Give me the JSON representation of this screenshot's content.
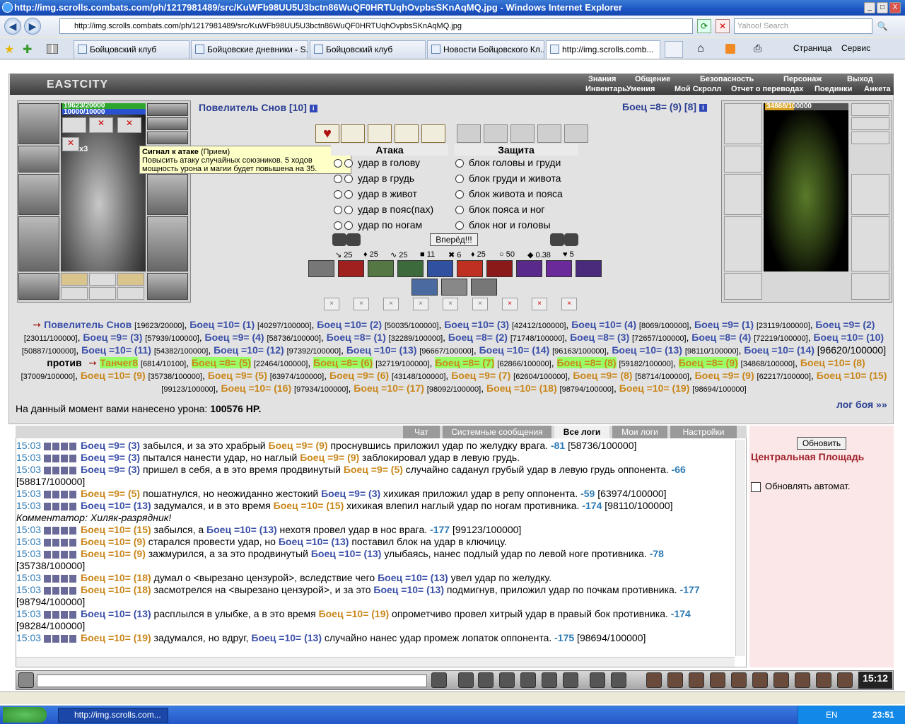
{
  "window": {
    "title": "http://img.scrolls.combats.com/ph/1217981489/src/KuWFb98UU5U3bctn86WuQF0HRTUqhOvpbsSKnAqMQ.jpg - Windows Internet Explorer",
    "min": "_",
    "max": "□",
    "close": "X"
  },
  "browser": {
    "url": "http://img.scrolls.combats.com/ph/1217981489/src/KuWFb98UU5U3bctn86WuQF0HRTUqhOvpbsSKnAqMQ.jpg",
    "search_placeholder": "Yahoo! Search",
    "page_menu": "Страница",
    "tools_menu": "Сервис"
  },
  "tabs": [
    {
      "label": "Бойцовский клуб"
    },
    {
      "label": "Бойцовские дневники - S..."
    },
    {
      "label": "Бойцовский клуб"
    },
    {
      "label": "Новости Бойцовского Кл..."
    },
    {
      "label": "http://img.scrolls.comb..."
    }
  ],
  "game": {
    "logo": "EASTCITY",
    "menu_top": [
      "Знания",
      "Общение",
      "Безопасность",
      "Персонаж",
      "Выход"
    ],
    "menu_bottom": [
      "Инвентарь",
      "Умения",
      "Мой Скролл",
      "Отчет о переводах",
      "Поединки",
      "Анкета"
    ],
    "left_player": {
      "name": "Повелитель Снов [10]",
      "hp": "19623/20000",
      "mana": "10000/10000",
      "mult": "x3"
    },
    "right_player": {
      "name": "Боец =8= (9) [8]",
      "hp": "34868/100000"
    },
    "tooltip": {
      "title": "Сигнал к атаке",
      "type": "(Прием)",
      "text": "Повысить атаку случайных союзников. 5 ходов мощность урона и магии будет повышена на 35."
    },
    "attack_header": "Атака",
    "defense_header": "Защита",
    "attacks": [
      "удар в голову",
      "удар в грудь",
      "удар в живот",
      "удар в пояс(пах)",
      "удар по ногам"
    ],
    "blocks": [
      "блок головы и груди",
      "блок груди и живота",
      "блок живота и пояса",
      "блок пояса и ног",
      "блок ног и головы"
    ],
    "forward_button": "Вперёд!!!",
    "stats": [
      "25",
      "25",
      "25",
      "11",
      "6",
      "25",
      "50",
      "0.38",
      "5"
    ],
    "damage_label": "На данный момент вами нанесено урона:",
    "damage_value": "100576 HP.",
    "battle_log_link": "лог боя »»",
    "vs": "против",
    "team1": [
      {
        "n": "Повелитель Снов",
        "hp": "[19623/20000]"
      },
      {
        "n": "Боец =10= (1)",
        "hp": "[40297/100000]"
      },
      {
        "n": "Боец =10= (2)",
        "hp": "[50035/100000]"
      },
      {
        "n": "Боец =10= (3)",
        "hp": "[42412/100000]"
      },
      {
        "n": "Боец =10= (4)",
        "hp": "[8069/100000]"
      },
      {
        "n": "Боец =9= (1)",
        "hp": "[23119/100000]"
      },
      {
        "n": "Боец =9= (2)",
        "hp": "[23011/100000]"
      },
      {
        "n": "Боец =9= (3)",
        "hp": "[57939/100000]"
      },
      {
        "n": "Боец =9= (4)",
        "hp": "[58736/100000]"
      },
      {
        "n": "Боец =8= (1)",
        "hp": "[32289/100000]"
      },
      {
        "n": "Боец =8= (2)",
        "hp": "[71748/100000]"
      },
      {
        "n": "Боец =8= (3)",
        "hp": "[72657/100000]"
      },
      {
        "n": "Боец =8= (4)",
        "hp": "[72219/100000]"
      },
      {
        "n": "Боец =10= (10)",
        "hp": "[50887/100000]"
      },
      {
        "n": "Боец =10= (11)",
        "hp": "[54382/100000]"
      },
      {
        "n": "Боец =10= (12)",
        "hp": "[97392/100000]"
      },
      {
        "n": "Боец =10= (13)",
        "hp": "[96667/100000]"
      },
      {
        "n": "Боец =10= (14)",
        "hp": "[96163/100000]"
      }
    ],
    "team1_last_hp": "[98110/100000]",
    "team2": [
      {
        "n": "Танчег8",
        "hp": "[6814/10100]",
        "hl": true
      },
      {
        "n": "Боец =8= (5)",
        "hp": "[22464/100000]",
        "hl": true
      },
      {
        "n": "Боец =8= (6)",
        "hp": "[32719/100000]",
        "hl": true
      },
      {
        "n": "Боец =8= (7)",
        "hp": "[62866/100000]",
        "hl": true
      },
      {
        "n": "Боец =8= (8)",
        "hp": "[59182/100000]",
        "hl": true
      },
      {
        "n": "Боец =8= (9)",
        "hp": "[34868/100000]",
        "hl": true
      },
      {
        "n": "Боец =10= (8)",
        "hp": "[37009/100000]"
      },
      {
        "n": "Боец =10= (9)",
        "hp": "[35738/100000]"
      },
      {
        "n": "Боец =9= (5)",
        "hp": "[63974/100000]"
      },
      {
        "n": "Боец =9= (6)",
        "hp": "[43148/100000]"
      },
      {
        "n": "Боец =9= (7)",
        "hp": "[62604/100000]"
      },
      {
        "n": "Боец =9= (8)",
        "hp": "[58714/100000]"
      },
      {
        "n": "Боец =9= (9)",
        "hp": "[62217/100000]"
      },
      {
        "n": "Боец =10= (15)",
        "hp": "[99123/100000]"
      },
      {
        "n": "Боец =10= (16)",
        "hp": "[97934/100000]"
      },
      {
        "n": "Боец =10= (17)",
        "hp": "[98092/100000]"
      },
      {
        "n": "Боец =10= (18)",
        "hp": "[98794/100000]"
      },
      {
        "n": "Боец =10= (19)",
        "hp": "[98694/100000]"
      }
    ]
  },
  "chat": {
    "tabs": [
      "Чат",
      "Системные сообщения",
      "Все логи",
      "Мои логи",
      "Настройки"
    ],
    "refresh_button": "Обновить",
    "location": "Центральная Площадь",
    "auto_refresh": "Обновлять автомат.",
    "log": [
      {
        "t": "15:03",
        "a": "Боец =9= (3)",
        "ac": "blue",
        "m": " забылся, и за это храбрый ",
        "b": "Боец =9= (9)",
        "bc": "orange",
        "e": " проснувшись приложил удар по желудку врага. ",
        "d": "-81",
        "hp": " [58736/100000]"
      },
      {
        "t": "15:03",
        "a": "Боец =9= (3)",
        "ac": "blue",
        "m": " пытался нанести удар, но наглый ",
        "b": "Боец =9= (9)",
        "bc": "orange",
        "e": " заблокировал удар в левую грудь.",
        "d": "",
        "hp": ""
      },
      {
        "t": "15:03",
        "a": "Боец =9= (3)",
        "ac": "blue",
        "m": " пришел в себя, а в это время продвинутый ",
        "b": "Боец =9= (5)",
        "bc": "orange",
        "e": " случайно саданул грубый удар в левую грудь оппонента. ",
        "d": "-66",
        "hp": " [58817/100000]"
      },
      {
        "t": "15:03",
        "a": "Боец =9= (5)",
        "ac": "orange",
        "m": " пошатнулся, но неожиданно жестокий ",
        "b": "Боец =9= (3)",
        "bc": "blue",
        "e": " хихикая приложил удар в репу оппонента. ",
        "d": "-59",
        "hp": " [63974/100000]"
      },
      {
        "t": "15:03",
        "a": "Боец =10= (13)",
        "ac": "blue",
        "m": " задумался, и в это время ",
        "b": "Боец =10= (15)",
        "bc": "orange",
        "e": " хихикая влепил наглый удар по ногам противника. ",
        "d": "-174",
        "hp": " [98110/100000]"
      },
      {
        "comment": "Комментатор: Хиляк-разрядник!"
      },
      {
        "t": "15:03",
        "a": "Боец =10= (15)",
        "ac": "orange",
        "m": " забылся, а ",
        "b": "Боец =10= (13)",
        "bc": "blue",
        "e": " нехотя провел удар в нос врага. ",
        "d": "-177",
        "hp": " [99123/100000]"
      },
      {
        "t": "15:03",
        "a": "Боец =10= (9)",
        "ac": "orange",
        "m": " старался провести удар, но ",
        "b": "Боец =10= (13)",
        "bc": "blue",
        "e": " поставил блок на удар в ключицу.",
        "d": "",
        "hp": ""
      },
      {
        "t": "15:03",
        "a": "Боец =10= (9)",
        "ac": "orange",
        "m": " зажмурился, а за это продвинутый ",
        "b": "Боец =10= (13)",
        "bc": "blue",
        "e": " улыбаясь, нанес подлый удар по левой ноге противника. ",
        "d": "-78",
        "hp": " [35738/100000]"
      },
      {
        "t": "15:03",
        "a": "Боец =10= (18)",
        "ac": "orange",
        "m": " думал о <вырезано цензурой>, вследствие чего ",
        "b": "Боец =10= (13)",
        "bc": "blue",
        "e": " увел удар по желудку.",
        "d": "",
        "hp": ""
      },
      {
        "t": "15:03",
        "a": "Боец =10= (18)",
        "ac": "orange",
        "m": " засмотрелся на <вырезано цензурой>, и за это ",
        "b": "Боец =10= (13)",
        "bc": "blue",
        "e": " подмигнув, приложил удар по почкам противника. ",
        "d": "-177",
        "hp": " [98794/100000]"
      },
      {
        "t": "15:03",
        "a": "Боец =10= (13)",
        "ac": "blue",
        "m": " расплылся в улыбке, а в это время ",
        "b": "Боец =10= (19)",
        "bc": "orange",
        "e": " опрометчиво провел хитрый удар в правый бок противника. ",
        "d": "-174",
        "hp": " [98284/100000]"
      },
      {
        "t": "15:03",
        "a": "Боец =10= (19)",
        "ac": "orange",
        "m": " задумался, но вдруг, ",
        "b": "Боец =10= (13)",
        "bc": "blue",
        "e": " случайно нанес удар промеж лопаток оппонента. ",
        "d": "-175",
        "hp": " [98694/100000]"
      }
    ]
  },
  "clock": "15:12",
  "taskbar": {
    "item": "http://img.scrolls.com...",
    "lang": "EN",
    "time": "23:51"
  },
  "colors": {
    "name_blue": "#3a4fa8",
    "name_orange": "#c9861a",
    "highlight": "#99ff66",
    "damage": "#2d7ab5"
  }
}
